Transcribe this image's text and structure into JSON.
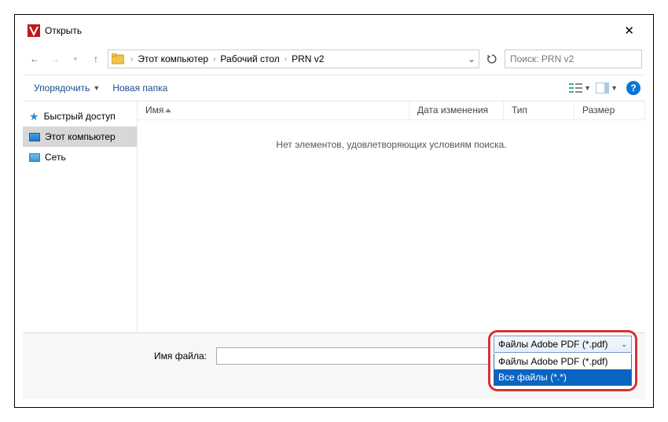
{
  "title": "Открыть",
  "nav": {
    "back": "←",
    "fwd": "→",
    "up": "↑"
  },
  "breadcrumbs": {
    "b0": "Этот компьютер",
    "b1": "Рабочий стол",
    "b2": "PRN v2"
  },
  "search_placeholder": "Поиск: PRN v2",
  "toolbar": {
    "organize": "Упорядочить",
    "newfolder": "Новая папка"
  },
  "navpane": {
    "quick": "Быстрый доступ",
    "thispc": "Этот компьютер",
    "network": "Сеть"
  },
  "headers": {
    "name": "Имя",
    "date": "Дата изменения",
    "type": "Тип",
    "size": "Размер"
  },
  "empty": "Нет элементов, удовлетворяющих условиям поиска.",
  "filename_label": "Имя файла:",
  "filter": {
    "selected": "Файлы Adobe PDF (*.pdf)",
    "opt0": "Файлы Adobe PDF (*.pdf)",
    "opt1": "Все файлы (*.*)"
  },
  "help": "?"
}
